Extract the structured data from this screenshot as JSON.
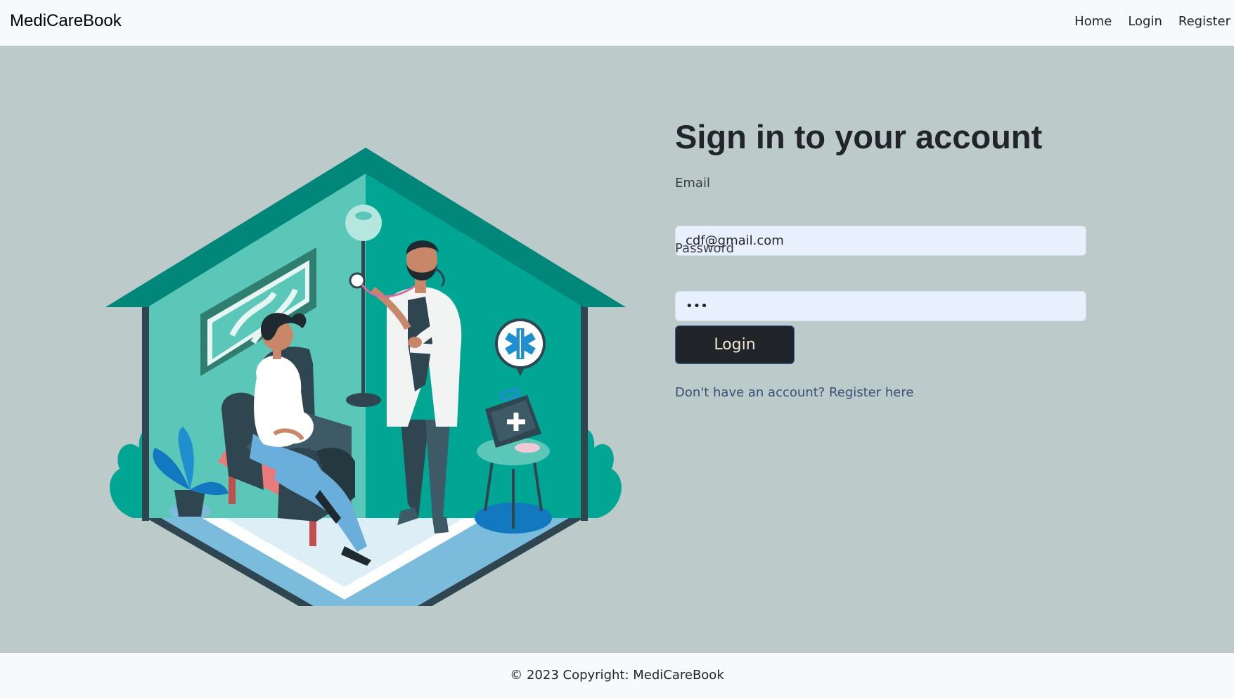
{
  "navbar": {
    "brand": "MediCareBook",
    "links": [
      "Home",
      "Login",
      "Register"
    ]
  },
  "login": {
    "title": "Sign in to your account",
    "email_label": "Email",
    "email_value": "cdf@gmail.com",
    "password_label": "Password",
    "password_value": "•••",
    "button": "Login",
    "register_link": "Don't have an account? Register here"
  },
  "footer": {
    "copyright": "© 2023 Copyright: MediCareBook"
  },
  "colors": {
    "page_bg": "#bccaca",
    "navbar_bg": "#f8f9fa",
    "button_bg": "#212529",
    "input_bg": "#e8f0fe",
    "teal": "#00a593"
  },
  "illustration": {
    "subject": "doctor-patient-house-illustration"
  }
}
